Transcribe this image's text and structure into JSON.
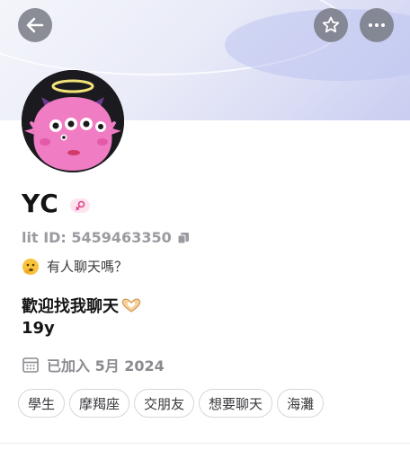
{
  "profile": {
    "name": "YC",
    "lit_id": "lit ID: 5459463350",
    "status_text": "有人聊天嗎？",
    "bio_line1": "歡迎找我聊天",
    "bio_line2": "19y",
    "joined_text": "已加入 5月 2024"
  },
  "tags": [
    "學生",
    "摩羯座",
    "交朋友",
    "想要聊天",
    "海灘"
  ],
  "icons": {
    "back": "back-arrow-icon",
    "favorite": "star-icon",
    "more": "more-icon",
    "copy": "copy-icon",
    "calendar": "calendar-icon"
  },
  "colors": {
    "banner": "#d9dcf4",
    "button_bg": "#78787f",
    "muted": "#9a9aa0"
  }
}
